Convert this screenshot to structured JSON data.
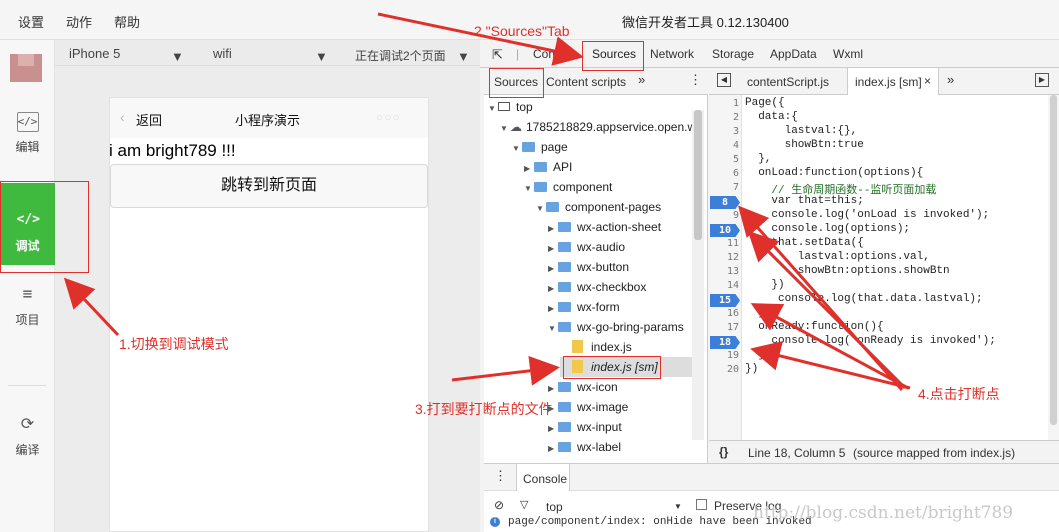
{
  "menubar": {
    "menus": [
      "设置",
      "动作",
      "帮助"
    ],
    "title": "微信开发者工具 0.12.130400"
  },
  "leftnav": [
    {
      "label": "编辑",
      "icon": "</>"
    },
    {
      "label": "调试",
      "icon": "</>"
    },
    {
      "label": "项目",
      "icon": "≡"
    },
    {
      "label": "编译",
      "icon": "⟳"
    }
  ],
  "simtoolbar": {
    "device": "iPhone 5",
    "network": "wifi",
    "debug_pages": "正在调试2个页面"
  },
  "phone": {
    "back": "返回",
    "title": "小程序演示",
    "dots": "○○○",
    "text": "i am bright789 !!!",
    "button": "跳转到新页面"
  },
  "devtools": {
    "tabs": [
      "Console",
      "Sources",
      "Network",
      "Storage",
      "AppData",
      "Wxml"
    ],
    "navtabs": [
      "Sources",
      "Content scripts"
    ],
    "tree": [
      "top",
      "1785218829.appservice.open.w",
      "page",
      "API",
      "component",
      "component-pages",
      "wx-action-sheet",
      "wx-audio",
      "wx-button",
      "wx-checkbox",
      "wx-form",
      "wx-go-bring-params",
      "index.js",
      "index.js [sm]",
      "wx-icon",
      "wx-image",
      "wx-input",
      "wx-label"
    ],
    "editor_tabs": [
      "contentScript.js",
      "index.js [sm]"
    ],
    "line_numbers": [
      "1",
      "2",
      "3",
      "4",
      "5",
      "6",
      "7",
      "8",
      "9",
      "10",
      "11",
      "12",
      "13",
      "14",
      "15",
      "16",
      "17",
      "18",
      "19",
      "20"
    ],
    "breakpoints": [
      "8",
      "10",
      "15",
      "18"
    ],
    "code": [
      "Page({",
      "  data:{",
      "      lastval:{},",
      "      showBtn:true",
      "  },",
      "  onLoad:function(options){",
      "    // 生命周期函数--监听页面加载",
      "    var that=this;",
      "    console.log('onLoad is invoked');",
      "    console.log(options);",
      "    that.setData({",
      "        lastval:options.val,",
      "        showBtn:options.showBtn",
      "    })",
      "     console.log(that.data.lastval);",
      "  },",
      "  onReady:function(){",
      "    console.log('onReady is invoked');",
      "  }",
      "})"
    ],
    "status": "Line 18, Column 5",
    "status_note": "(source mapped from index.js)",
    "status_brace": "{}",
    "console_tab": "Console",
    "console_filter": "top",
    "preserve_log": "Preserve log",
    "console_msg": "page/component/index: onHide have been invoked"
  },
  "annotations": {
    "a1": "1.切换到调试模式",
    "a2": "2.\"Sources\"Tab",
    "a3": "3.打到要打断点的文件",
    "a4": "4.点击打断点",
    "watermark": "http://blog.csdn.net/bright789"
  },
  "colors": {
    "active_nav": "#3fba3f",
    "breakpoint": "#3c7ed8",
    "annotation": "#e0302b"
  }
}
